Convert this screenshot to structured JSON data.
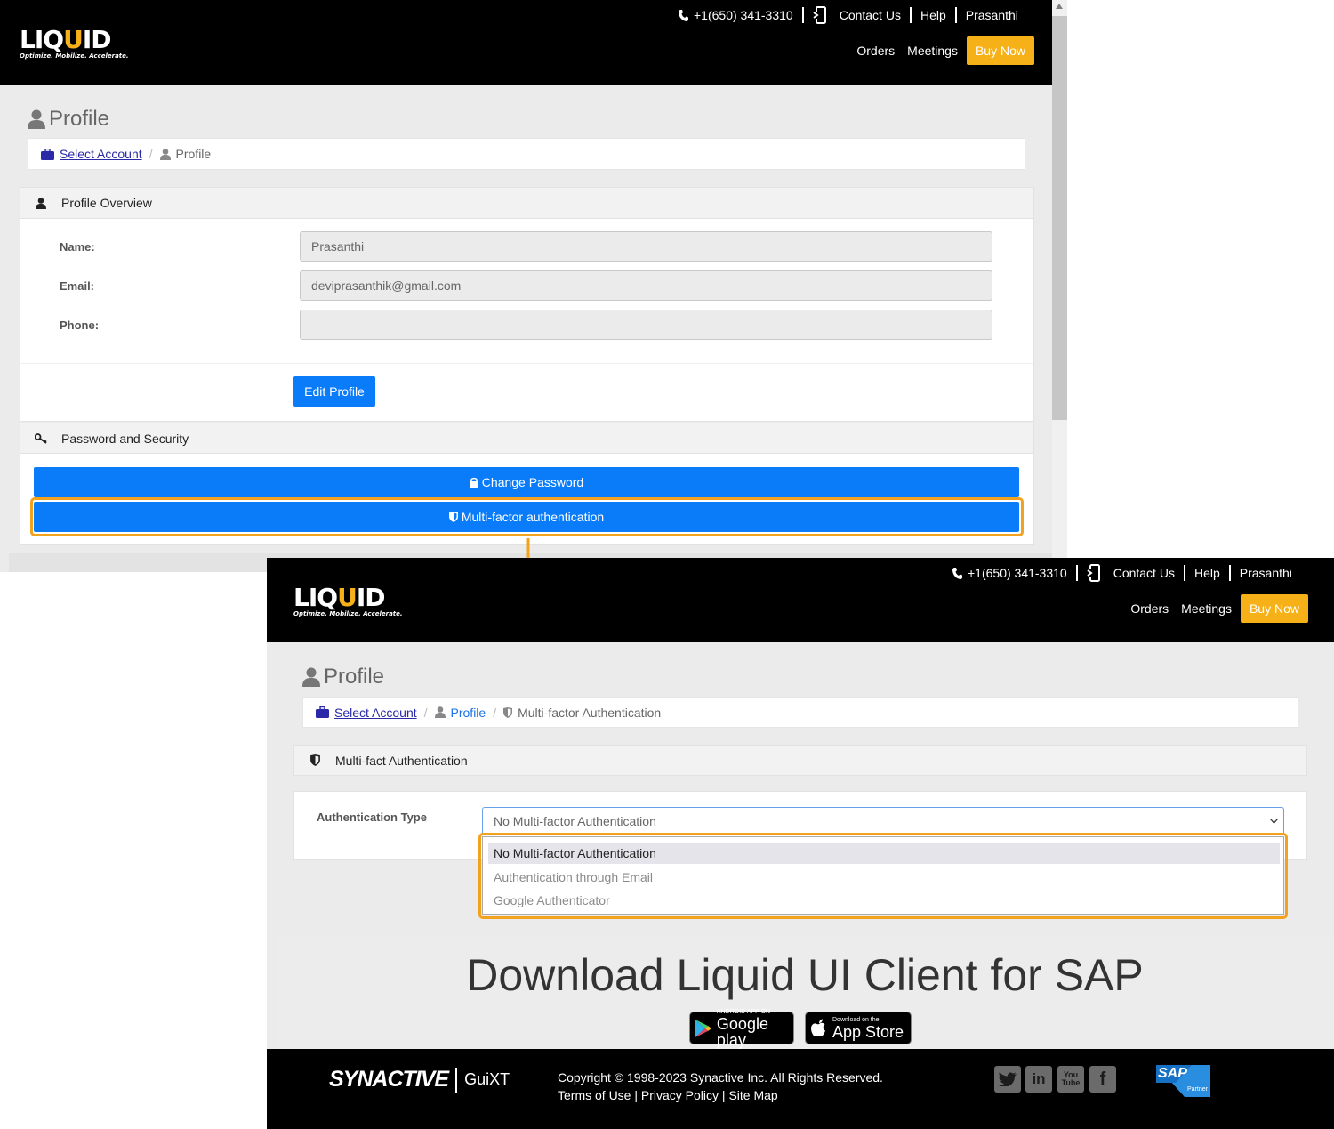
{
  "header": {
    "logo_word_a": "LIQ",
    "logo_word_u": "U",
    "logo_word_b": "ID",
    "logo_tagline": "Optimize. Mobilize. Accelerate.",
    "phone": "+1(650) 341-3310",
    "contact": "Contact Us",
    "help": "Help",
    "user": "Prasanthi",
    "orders": "Orders",
    "meetings": "Meetings",
    "buy_now": "Buy Now"
  },
  "profile_page": {
    "title": "Profile",
    "breadcrumb": {
      "select_account": "Select Account",
      "current": "Profile"
    },
    "overview": {
      "heading": "Profile Overview",
      "name_label": "Name:",
      "name_value": "Prasanthi",
      "email_label": "Email:",
      "email_value": "deviprasanthik@gmail.com",
      "phone_label": "Phone:",
      "phone_value": "",
      "edit_button": "Edit Profile"
    },
    "security": {
      "heading": "Password and Security",
      "change_password": "Change Password",
      "mfa": "Multi-factor authentication"
    }
  },
  "mfa_page": {
    "title": "Profile",
    "breadcrumb": {
      "select_account": "Select Account",
      "profile": "Profile",
      "current": "Multi-factor Authentication"
    },
    "panel_heading": "Multi-fact Authentication",
    "auth_type_label": "Authentication Type",
    "auth_type_selected": "No Multi-factor Authentication",
    "auth_options": [
      "No Multi-factor Authentication",
      "Authentication through Email",
      "Google Authenticator"
    ],
    "download_title": "Download Liquid UI Client for SAP",
    "google_play_small": "ANDROID APP ON",
    "google_play_big": "Google play",
    "app_store_small": "Download on the",
    "app_store_big": "App Store"
  },
  "footer": {
    "brand": "SYNACTIVE",
    "product": "GuiXT",
    "copyright": "Copyright © 1998-2023 Synactive Inc. All Rights Reserved.",
    "terms": "Terms of Use",
    "privacy": "Privacy Policy",
    "sitemap": "Site Map",
    "sap": "SAP",
    "sap_partner": "Partner"
  },
  "colors": {
    "accent": "#f6b018",
    "primary_button": "#0a7cf9",
    "highlight": "#f3a21d"
  },
  "icons": [
    "phone-icon",
    "mobile-icon",
    "user-icon",
    "briefcase-icon",
    "key-icon",
    "lock-icon",
    "shield-icon",
    "chevron-down-icon",
    "twitter-icon",
    "linkedin-icon",
    "youtube-icon",
    "facebook-icon",
    "google-play-icon",
    "apple-icon"
  ]
}
